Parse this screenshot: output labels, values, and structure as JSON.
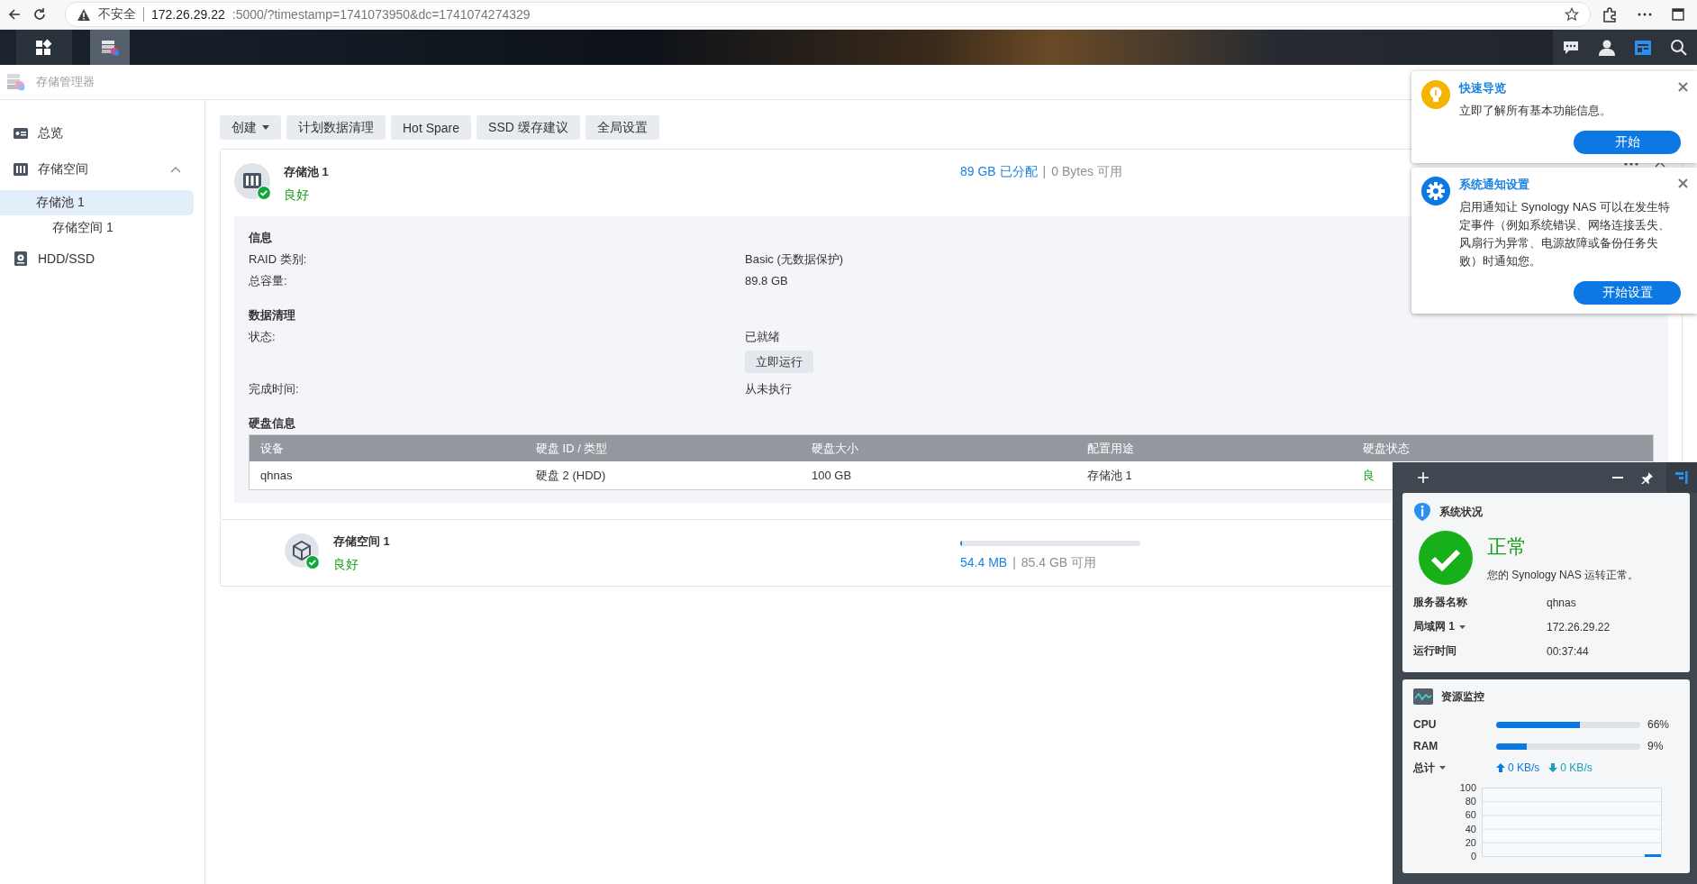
{
  "browser": {
    "security_label": "不安全",
    "url_host": "172.26.29.22",
    "url_rest": ":5000/?timestamp=1741073950&dc=1741074274329"
  },
  "taskbar": {
    "apps": [
      {
        "kind": "grid",
        "selected": false
      },
      {
        "kind": "storage",
        "selected": true
      }
    ],
    "tray": [
      {
        "kind": "chat",
        "selected": false
      },
      {
        "kind": "user",
        "selected": false
      },
      {
        "kind": "widgets",
        "selected": true
      },
      {
        "kind": "search",
        "selected": false
      }
    ]
  },
  "app": {
    "title": "存储管理器"
  },
  "sidebar": {
    "items": [
      {
        "label": "总览",
        "kind": "overview",
        "selected": false
      },
      {
        "label": "存储空间",
        "kind": "storage",
        "selected": false,
        "expanded": true,
        "children": [
          {
            "label": "存储池 1",
            "selected": true,
            "children": [
              {
                "label": "存储空间 1",
                "selected": false
              }
            ]
          }
        ]
      },
      {
        "label": "HDD/SSD",
        "kind": "disk",
        "selected": false
      }
    ]
  },
  "toolbar": [
    {
      "label": "创建",
      "dropdown": true
    },
    {
      "label": "计划数据清理",
      "dropdown": false
    },
    {
      "label": "Hot Spare",
      "dropdown": false
    },
    {
      "label": "SSD 缓存建议",
      "dropdown": false
    },
    {
      "label": "全局设置",
      "dropdown": false
    }
  ],
  "pool": {
    "title": "存储池 1",
    "status": "良好",
    "allocated": "89 GB 已分配",
    "separator": "|",
    "available": "0 Bytes 可用",
    "expanded": true,
    "sections": [
      {
        "title": "信息",
        "rows": [
          {
            "label": "RAID 类别:",
            "value": "Basic (无数据保护)"
          },
          {
            "label": "总容量:",
            "value": "89.8 GB"
          }
        ]
      },
      {
        "title": "数据清理",
        "rows": [
          {
            "label": "状态:",
            "value": "已就绪",
            "button": "立即运行"
          },
          {
            "label": "完成时间:",
            "value": "从未执行"
          }
        ]
      }
    ],
    "disks": {
      "title": "硬盘信息",
      "columns": [
        "设备",
        "硬盘 ID / 类型",
        "硬盘大小",
        "配置用途",
        "硬盘状态"
      ],
      "rows": [
        [
          "qhnas",
          "硬盘 2 (HDD)",
          "100 GB",
          "存储池 1",
          "良"
        ]
      ]
    }
  },
  "volume": {
    "title": "存储空间 1",
    "status": "良好",
    "level": 0.01,
    "used": "54.4 MB",
    "separator": "|",
    "available": "85.4 GB 可用"
  },
  "notifications": [
    {
      "kind": "tip",
      "title": "快速导览",
      "body": "立即了解所有基本功能信息。",
      "button": "开始"
    },
    {
      "kind": "settings",
      "title": "系统通知设置",
      "body": "启用通知让 Synology NAS 可以在发生特定事件（例如系统错误、网络连接丢失、风扇行为异常、电源故障或备份任务失败）时通知您。",
      "button": "开始设置"
    }
  ],
  "widgets": {
    "system": {
      "title": "系统状况",
      "state": "正常",
      "message": "您的 Synology NAS 运转正常。",
      "rows": [
        {
          "label": "服务器名称",
          "value": "qhnas",
          "dropdown": false
        },
        {
          "label": "局域网 1",
          "value": "172.26.29.22",
          "dropdown": true
        },
        {
          "label": "运行时间",
          "value": "00:37:44",
          "dropdown": false
        }
      ]
    },
    "resources": {
      "title": "资源监控",
      "meters": [
        {
          "label": "CPU",
          "level": 0.58,
          "reading": "66%"
        },
        {
          "label": "RAM",
          "level": 0.21,
          "reading": "9%"
        }
      ],
      "network": {
        "label": "总计",
        "upload": "0 KB/s",
        "download": "0 KB/s"
      },
      "traffic_graph": {
        "axis_labels": [
          "100",
          "80",
          "60",
          "40",
          "20",
          "0"
        ]
      }
    }
  }
}
